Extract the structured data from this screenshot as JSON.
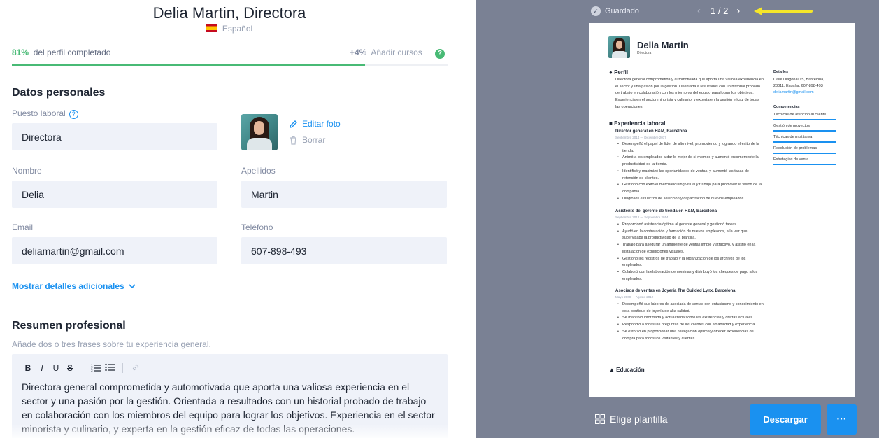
{
  "header": {
    "title": "Delia Martin, Directora",
    "language": "Español"
  },
  "progress": {
    "percent_value": "81%",
    "percent_label": "del perfil completado",
    "add_value": "+4%",
    "add_label": "Añadir cursos",
    "help": "?",
    "completion": 0.81
  },
  "personal": {
    "section_title": "Datos personales",
    "job_label": "Puesto laboral",
    "job_value": "Directora",
    "edit_photo": "Editar foto",
    "delete_photo": "Borrar",
    "first_name_label": "Nombre",
    "first_name_value": "Delia",
    "last_name_label": "Apellidos",
    "last_name_value": "Martin",
    "email_label": "Email",
    "email_value": "deliamartin@gmail.com",
    "phone_label": "Teléfono",
    "phone_value": "607-898-493",
    "more_details": "Mostrar detalles adicionales"
  },
  "summary": {
    "section_title": "Resumen profesional",
    "hint": "Añade dos o tres frases sobre tu experiencia general.",
    "toolbar": [
      "B",
      "I",
      "U",
      "S"
    ],
    "text": "Directora general comprometida y automotivada que aporta una valiosa experiencia en el sector y una pasión por la gestión. Orientada a resultados con un historial probado de trabajo en colaboración con los miembros del equipo para lograr los objetivos. Experiencia en el sector minorista y culinario, y experta en la gestión eficaz de todas las operaciones."
  },
  "preview": {
    "saved": "Guardado",
    "page": "1 / 2",
    "choose_template": "Elige plantilla",
    "download": "Descargar",
    "more": "···"
  },
  "resume": {
    "name": "Delia Martin",
    "role": "Directora",
    "profile_title": "Perfil",
    "profile_text": "Directora general comprometida y automotivada que aporta una valiosa experiencia en el sector y una pasión por la gestión. Orientada a resultados con un historial probado de trabajo en colaboración con los miembros del equipo para lograr los objetivos. Experiencia en el sector minorista y culinario, y experta en la gestión eficaz de todas las operaciones.",
    "experience_title": "Experiencia laboral",
    "jobs": [
      {
        "title": "Director general en H&M, Barcelona",
        "dates": "Septiembre 2014 — Diciembre 2017",
        "bullets": [
          "Desempeñó el papel de líder de alto nivel, promoviendo y logrando el éxito de la tienda.",
          "Animó a los empleados a dar lo mejor de sí mismos y aumentó enormemente la productividad de la tienda.",
          "Identificó y maximizó las oportunidades de ventas, y aumentó las tasas de retención de clientes.",
          "Gestionó con éxito el merchandising visual y trabajó para promover la visión de la compañía.",
          "Dirigió los esfuerzos de selección y capacitación de nuevos empleados."
        ]
      },
      {
        "title": "Asistente del gerente de tienda en H&M, Barcelona",
        "dates": "Septiembre 2012 — Septiembre 2014",
        "bullets": [
          "Proporcionó asistencia óptima al gerente general y gestionó tareas.",
          "Ayudó en la contratación y formación de nuevos empleados, a la vez que supervisaba la productividad de la plantilla.",
          "Trabajó para asegurar un ambiente de ventas limpio y atractivo, y asistió en la instalación de exhibiciones visuales.",
          "Gestionó los registros de trabajo y la organización de los archivos de los empleados.",
          "Colaboró con la elaboración de nóminas y distribuyó los cheques de pago a los empleados."
        ]
      },
      {
        "title": "Asociada de ventas en Joyería The Guilded Lynx, Barcelona",
        "dates": "Mayo 2009 — Agosto 2012",
        "bullets": [
          "Desempeñó sus labores de asociada de ventas con entusiasmo y conocimiento en esta boutique de joyería de alta calidad.",
          "Se mantuvo informada y actualizada sobre las existencias y ofertas actuales.",
          "Respondió a todas las preguntas de los clientes con amabilidad y experiencia.",
          "Se esforzó en proporcionar una navegación óptima y ofrecer experiencias de compra para todos los visitantes y clientes."
        ]
      }
    ],
    "education_title": "Educación",
    "details_title": "Detalles",
    "address": "Calle Diagonal 15, Barcelona, 28011, España, 607-898-493",
    "email": "deliamartin@gmail.com",
    "skills_title": "Competencias",
    "skills": [
      "Técnicas de atención al cliente",
      "Gestión de proyectos",
      "Técnicas de multitarea",
      "Resolución de problemas",
      "Estrategias de venta"
    ]
  },
  "colors": {
    "accent": "#1a91f0",
    "success": "#48ba75",
    "preview_bg": "#7a8194",
    "arrow": "#f5e62a"
  }
}
